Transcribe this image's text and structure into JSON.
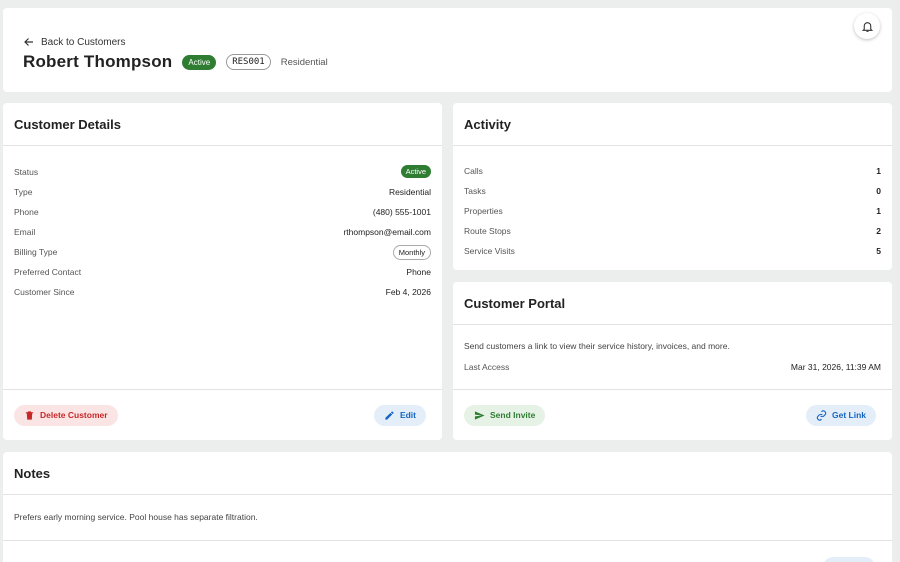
{
  "header": {
    "back_label": "Back to Customers",
    "customer_name": "Robert Thompson",
    "status_badge": "Active",
    "customer_code": "RES001",
    "customer_type": "Residential"
  },
  "details": {
    "title": "Customer Details",
    "rows": [
      {
        "label": "Status",
        "value": "Active"
      },
      {
        "label": "Type",
        "value": "Residential"
      },
      {
        "label": "Phone",
        "value": "(480) 555-1001"
      },
      {
        "label": "Email",
        "value": "rthompson@email.com"
      },
      {
        "label": "Billing Type",
        "value": "Monthly"
      },
      {
        "label": "Preferred Contact",
        "value": "Phone"
      },
      {
        "label": "Customer Since",
        "value": "Feb 4, 2026"
      }
    ],
    "delete_label": "Delete Customer",
    "edit_label": "Edit"
  },
  "activity": {
    "title": "Activity",
    "rows": [
      {
        "label": "Calls",
        "value": "1"
      },
      {
        "label": "Tasks",
        "value": "0"
      },
      {
        "label": "Properties",
        "value": "1"
      },
      {
        "label": "Route Stops",
        "value": "2"
      },
      {
        "label": "Service Visits",
        "value": "5"
      }
    ]
  },
  "portal": {
    "title": "Customer Portal",
    "description": "Send customers a link to view their service history, invoices, and more.",
    "last_access_label": "Last Access",
    "last_access_value": "Mar 31, 2026, 11:39 AM",
    "send_invite_label": "Send Invite",
    "get_link_label": "Get Link"
  },
  "notes": {
    "title": "Notes",
    "text": "Prefers early morning service. Pool house has separate filtration."
  },
  "colors": {
    "active_green": "#2e7d32",
    "danger_red": "#c62828",
    "link_blue": "#1565c0",
    "background": "#eceeee"
  },
  "icons": {
    "back": "arrow-left-icon",
    "notifications": "bell-icon",
    "delete": "trash-icon",
    "edit": "pencil-icon",
    "send": "send-icon",
    "link": "link-icon"
  }
}
